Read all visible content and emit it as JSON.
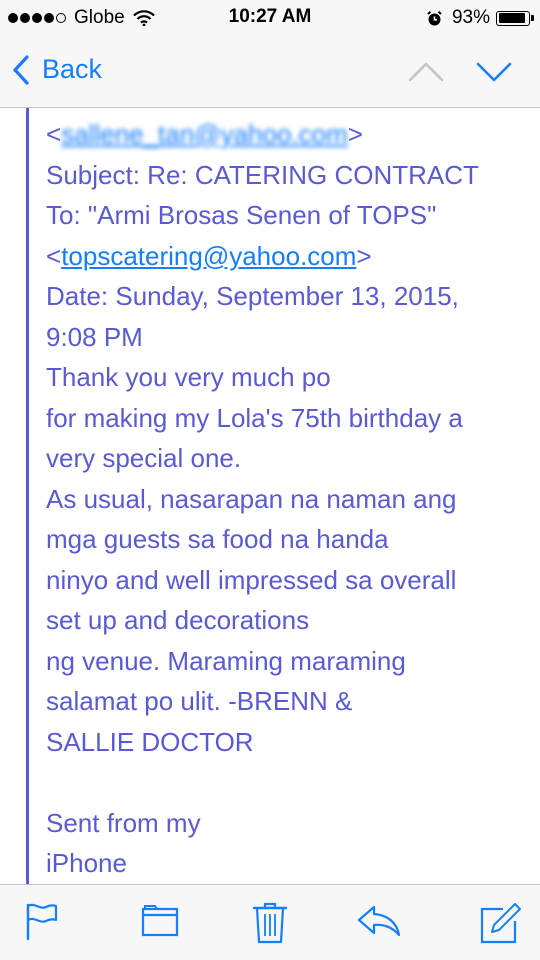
{
  "status_bar": {
    "carrier": "Globe",
    "time": "10:27 AM",
    "battery_percent": "93%",
    "battery_level": 0.93,
    "icons": [
      "signal-dots-icon",
      "wifi-icon",
      "alarm-clock-icon",
      "battery-icon"
    ]
  },
  "nav": {
    "back_label": "Back",
    "icons": [
      "back-chevron-icon",
      "previous-message-icon",
      "next-message-icon"
    ]
  },
  "email": {
    "from_open": "<",
    "from_email": "sallene_tan@yahoo.com",
    "from_close": ">",
    "subject": "Subject: Re: CATERING CONTRACT",
    "to": "To: \"Armi Brosas Senen of TOPS\"",
    "to_open": "<",
    "to_email": "topscatering@yahoo.com",
    "to_close": ">",
    "date_line1": "Date: Sunday, September 13, 2015,",
    "date_line2": "9:08 PM",
    "body_lines": [
      "Thank you very much po",
      "for making my Lola's 75th birthday a",
      "very special one.",
      "As usual, nasarapan na naman ang",
      "mga guests sa food na handa",
      "ninyo and well impressed sa overall",
      "set up and decorations",
      "ng venue. Maraming maraming",
      "salamat po ulit. -BRENN &",
      "SALLIE DOCTOR"
    ],
    "signature_line1": "Sent from my",
    "signature_line2": "iPhone"
  },
  "toolbar": {
    "icons": [
      "flag-icon",
      "folder-icon",
      "trash-icon",
      "reply-icon",
      "compose-icon"
    ]
  },
  "colors": {
    "accent": "#157efb",
    "quoted_text": "#5a5ad2",
    "quote_bar": "#5b5bd6",
    "bar_background": "#f7f7f7"
  }
}
